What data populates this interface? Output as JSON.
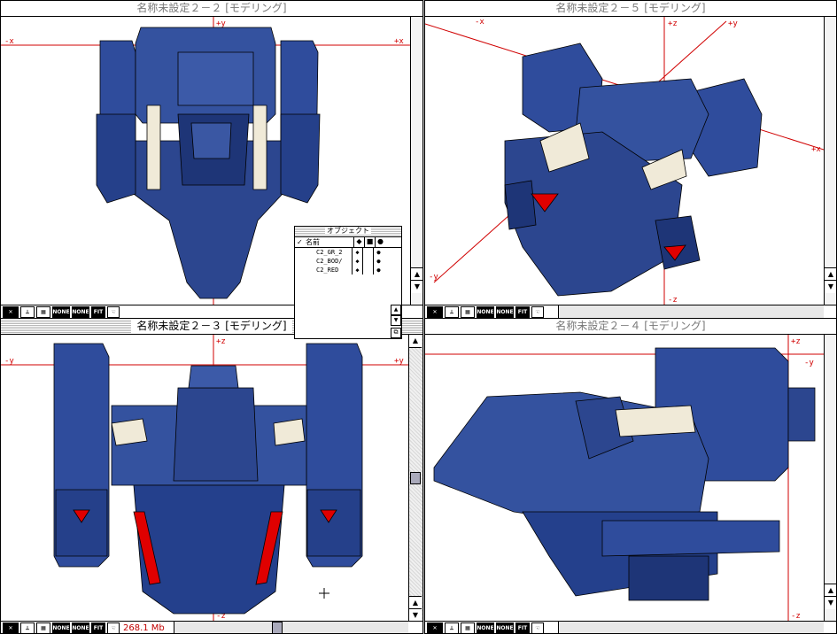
{
  "windows": {
    "top_left": {
      "title": "名称未設定２－２ [モデリング]",
      "axes": {
        "left": "-x",
        "right": "+x",
        "top": "+y"
      }
    },
    "top_right": {
      "title": "名称未設定２－５ [モデリング]",
      "axes": {
        "a": "-x",
        "b": "+z",
        "c": "+y",
        "d": "+x",
        "e": "-y",
        "f": "-z"
      }
    },
    "bottom_left": {
      "title": "名称未設定２－３ [モデリング]",
      "axes": {
        "left": "-y",
        "right": "+y",
        "top": "+z",
        "bottom": "-z"
      },
      "memory": "268.1 Mb"
    },
    "bottom_right": {
      "title": "名称未設定２－４ [モデリング]",
      "axes": {
        "top": "+z",
        "right": "-y",
        "bottom": "-z"
      }
    }
  },
  "toolbar": {
    "none1": "NONE",
    "none2": "NONE",
    "fit": "FIT"
  },
  "object_panel": {
    "title": "オブジェクト",
    "header": {
      "check": "✓",
      "name": "名前",
      "c1": "◆",
      "c3": "●"
    },
    "rows": [
      {
        "name": "C2_GR_2",
        "c1": "◆",
        "c3": "●"
      },
      {
        "name": "C2_BOD/",
        "c1": "◆",
        "c3": "●"
      },
      {
        "name": "C2_RED",
        "c1": "◆",
        "c3": "●"
      }
    ]
  },
  "colors": {
    "model_blue": "#2e4a9a",
    "axis_red": "#d00000",
    "accent_red": "#e00000"
  }
}
